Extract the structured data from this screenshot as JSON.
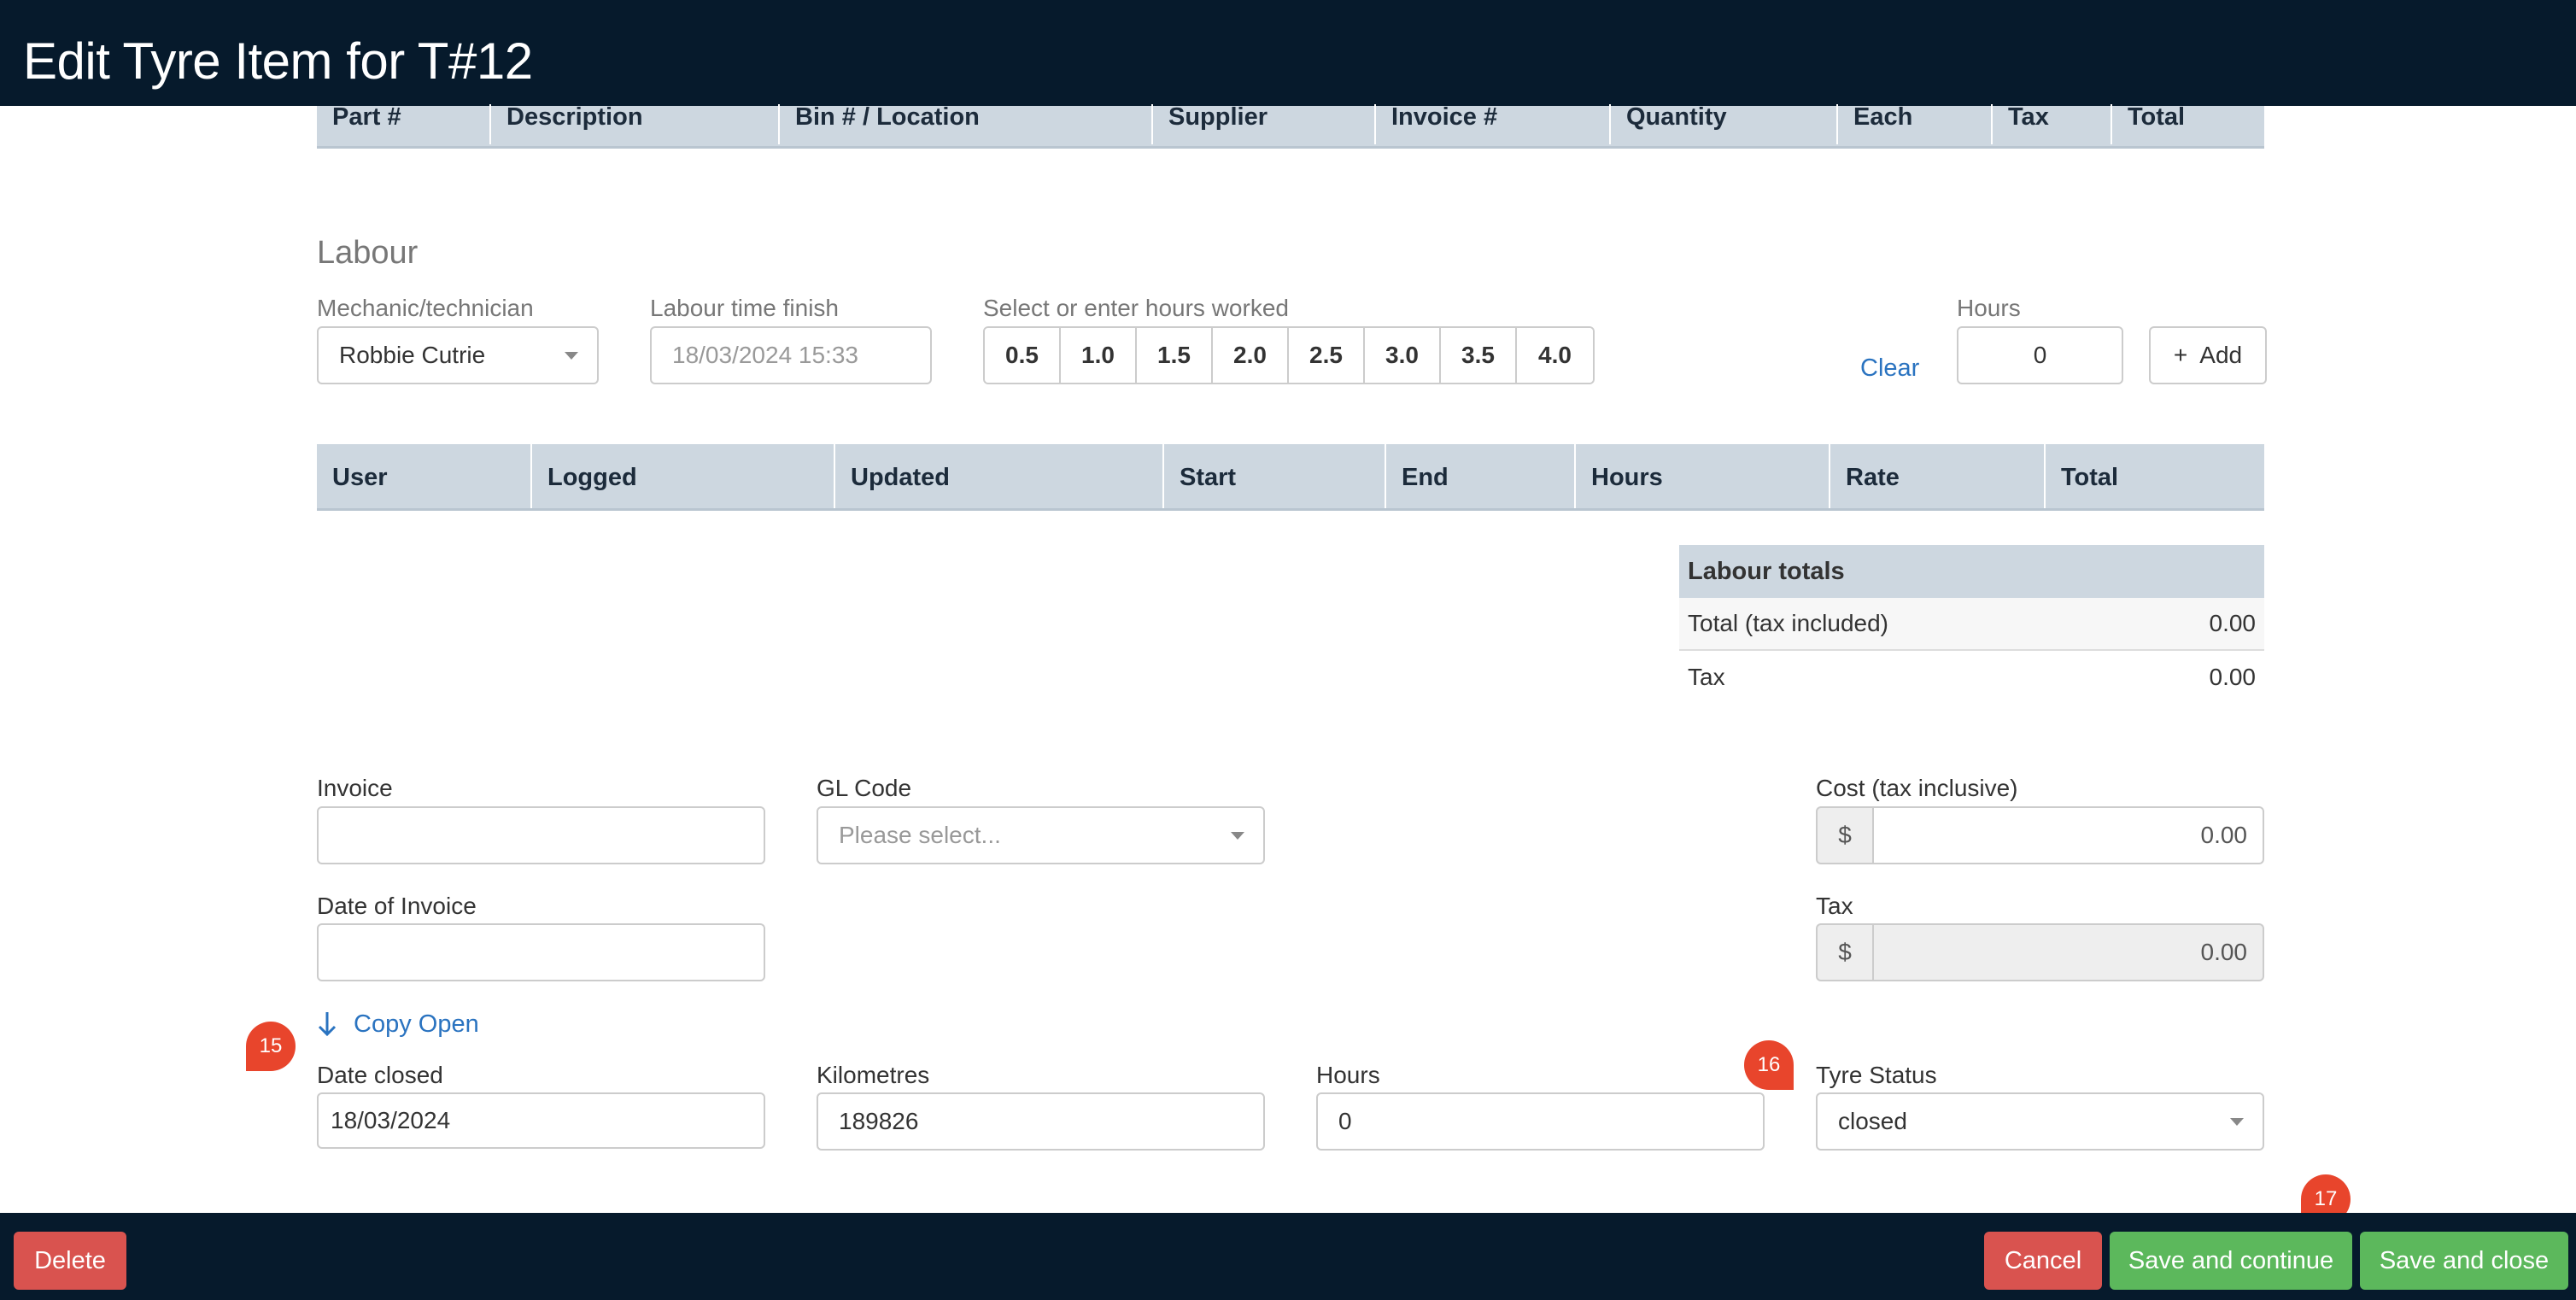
{
  "header": {
    "title": "Edit Tyre Item for T#12"
  },
  "parts_table": {
    "columns": [
      "Part #",
      "Description",
      "Bin # / Location",
      "Supplier",
      "Invoice #",
      "Quantity",
      "Each",
      "Tax",
      "Total"
    ]
  },
  "labour": {
    "title": "Labour",
    "mechanic_label": "Mechanic/technician",
    "mechanic_value": "Robbie Cutrie",
    "finish_label": "Labour time finish",
    "finish_placeholder": "18/03/2024 15:33",
    "hours_select_label": "Select or enter hours worked",
    "hour_options": [
      "0.5",
      "1.0",
      "1.5",
      "2.0",
      "2.5",
      "3.0",
      "3.5",
      "4.0"
    ],
    "clear_label": "Clear",
    "hours_label": "Hours",
    "hours_value": "0",
    "add_label": "+  Add",
    "table_columns": [
      "User",
      "Logged",
      "Updated",
      "Start",
      "End",
      "Hours",
      "Rate",
      "Total"
    ]
  },
  "labour_totals": {
    "title": "Labour totals",
    "total_label": "Total (tax included)",
    "total_value": "0.00",
    "tax_label": "Tax",
    "tax_value": "0.00"
  },
  "invoice": {
    "invoice_label": "Invoice",
    "invoice_value": "",
    "gl_label": "GL Code",
    "gl_placeholder": "Please select...",
    "date_label": "Date of Invoice",
    "date_value": "",
    "cost_label": "Cost (tax inclusive)",
    "currency": "$",
    "cost_value": "0.00",
    "tax_label": "Tax",
    "tax_value": "0.00",
    "copy_open_label": "Copy Open"
  },
  "closing": {
    "date_closed_label": "Date closed",
    "date_closed_value": "18/03/2024",
    "km_label": "Kilometres",
    "km_value": "189826",
    "hours_label": "Hours",
    "hours_value": "0",
    "status_label": "Tyre Status",
    "status_value": "closed"
  },
  "badges": {
    "b15": "15",
    "b16": "16",
    "b17": "17"
  },
  "footer": {
    "delete_label": "Delete",
    "cancel_label": "Cancel",
    "save_continue_label": "Save and continue",
    "save_close_label": "Save and close"
  },
  "colors": {
    "header_bg": "#061a2c",
    "table_head_bg": "#cdd7e0",
    "danger": "#d9534f",
    "success": "#5cb85c",
    "badge": "#e8452c",
    "link": "#2a73c0"
  }
}
